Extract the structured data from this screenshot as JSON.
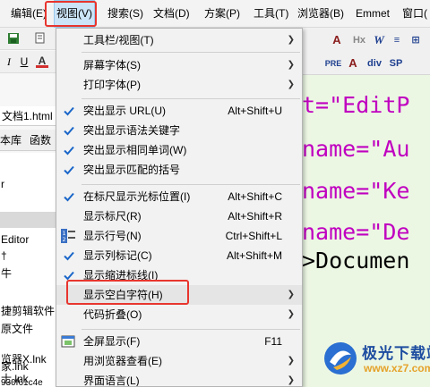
{
  "menubar": {
    "items": [
      {
        "label": "编辑(E)"
      },
      {
        "label": "视图(V)"
      },
      {
        "label": "搜索(S)"
      },
      {
        "label": "文档(D)"
      },
      {
        "label": "方案(P)"
      },
      {
        "label": "工具(T)"
      },
      {
        "label": "浏览器(B)"
      },
      {
        "label": "Emmet"
      },
      {
        "label": "窗口("
      }
    ]
  },
  "left": {
    "file_tab": "文档1.html",
    "tabs": [
      "本库",
      "函数"
    ],
    "list": [
      "r",
      "Editor",
      "†",
      "牛",
      "捷剪辑软件",
      "原文件",
      "览器X.lnk",
      "士.lnk",
      "家.lnk",
      "930f61c4e"
    ]
  },
  "right_toolbar": {
    "buttons": [
      "A",
      "Hx",
      "W",
      "≡",
      "⊞",
      "PRE",
      "A",
      "div",
      "SP"
    ]
  },
  "editor": {
    "lines": [
      {
        "plain": "t=",
        "str": "\"EditP"
      },
      {
        "plain": "name=",
        "str": "\"Au"
      },
      {
        "plain": "name=",
        "str": "\"Ke"
      },
      {
        "plain": "name=",
        "str": "\"De"
      },
      {
        "plain": ">Documen",
        "str": ""
      }
    ]
  },
  "menu": {
    "items": [
      {
        "label": "工具栏/视图(T)",
        "shortcut": "",
        "submenu": true,
        "checked": false
      },
      {
        "label": "屏幕字体(S)",
        "shortcut": "",
        "submenu": true,
        "checked": false
      },
      {
        "label": "打印字体(P)",
        "shortcut": "",
        "submenu": true,
        "checked": false
      },
      {
        "label": "突出显示 URL(U)",
        "shortcut": "Alt+Shift+U",
        "submenu": false,
        "checked": true
      },
      {
        "label": "突出显示语法关键字",
        "shortcut": "",
        "submenu": false,
        "checked": true
      },
      {
        "label": "突出显示相同单词(W)",
        "shortcut": "",
        "submenu": false,
        "checked": true
      },
      {
        "label": "突出显示匹配的括号",
        "shortcut": "",
        "submenu": false,
        "checked": true
      },
      {
        "label": "在标尺显示光标位置(I)",
        "shortcut": "Alt+Shift+C",
        "submenu": false,
        "checked": true
      },
      {
        "label": "显示标尺(R)",
        "shortcut": "Alt+Shift+R",
        "submenu": false,
        "checked": false
      },
      {
        "label": "显示行号(N)",
        "shortcut": "Ctrl+Shift+L",
        "submenu": false,
        "checked": false
      },
      {
        "label": "显示列标记(C)",
        "shortcut": "Alt+Shift+M",
        "submenu": false,
        "checked": true
      },
      {
        "label": "显示缩进标线(I)",
        "shortcut": "",
        "submenu": false,
        "checked": true
      },
      {
        "label": "显示空白字符(H)",
        "shortcut": "",
        "submenu": true,
        "checked": false
      },
      {
        "label": "代码折叠(O)",
        "shortcut": "",
        "submenu": true,
        "checked": false
      },
      {
        "label": "全屏显示(F)",
        "shortcut": "F11",
        "submenu": false,
        "checked": false
      },
      {
        "label": "用浏览器查看(E)",
        "shortcut": "",
        "submenu": true,
        "checked": false
      },
      {
        "label": "界面语言(L)",
        "shortcut": "",
        "submenu": true,
        "checked": false
      }
    ]
  },
  "watermark": {
    "title": "极光下载站",
    "url": "www.xz7.com"
  },
  "colors": {
    "highlight_box": "#e8352e",
    "check": "#1a66c9",
    "code_string": "#c000c0",
    "code_plain": "#000000",
    "editor_bg": "#ecf7e3"
  },
  "icons": [
    "check-icon",
    "line-number-icon",
    "fullscreen-icon",
    "submenu-arrow-icon",
    "save-icon",
    "bold-icon",
    "italic-icon",
    "underline-icon",
    "font-color-icon"
  ]
}
